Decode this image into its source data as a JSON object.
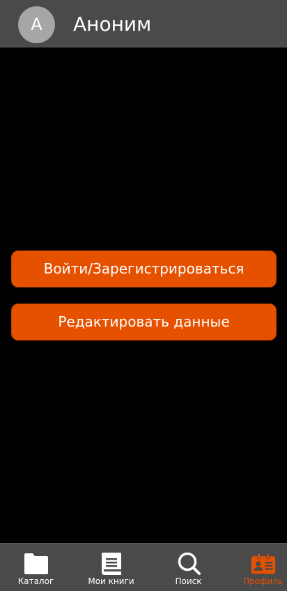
{
  "header": {
    "avatar_letter": "A",
    "username": "Аноним"
  },
  "actions": {
    "login_label": "Войти/Зарегистрироваться",
    "edit_label": "Редактировать данные"
  },
  "bottom_nav": {
    "items": [
      {
        "label": "Каталог",
        "icon": "folder-icon",
        "active": false
      },
      {
        "label": "Мои книги",
        "icon": "book-icon",
        "active": false
      },
      {
        "label": "Поиск",
        "icon": "search-icon",
        "active": false
      },
      {
        "label": "Профиль",
        "icon": "profile-card-icon",
        "active": true
      }
    ]
  },
  "colors": {
    "accent": "#e65100",
    "bar_background": "#4a4a4a",
    "page_background": "#000000",
    "avatar_background": "#a6a6a6"
  }
}
